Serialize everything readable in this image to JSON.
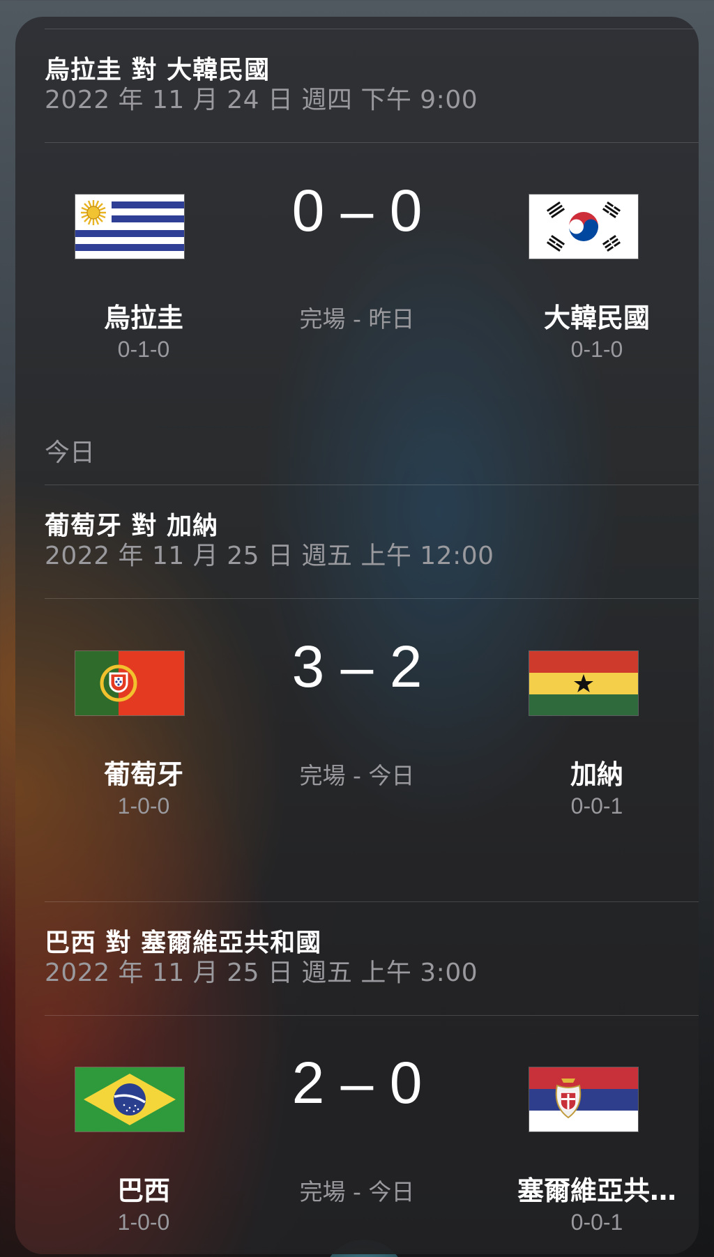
{
  "matches": [
    {
      "title": "烏拉圭 對 大韓民國",
      "datetime": "2022 年 11 月 24 日 週四 下午 9:00",
      "score": "0 – 0",
      "status": "完場 - 昨日",
      "home": {
        "name": "烏拉圭",
        "record": "0-1-0",
        "flag_icon": "uruguay-flag-icon"
      },
      "away": {
        "name": "大韓民國",
        "record": "0-1-0",
        "flag_icon": "south-korea-flag-icon"
      }
    },
    {
      "title": "葡萄牙 對 加納",
      "datetime": "2022 年 11 月 25 日 週五 上午 12:00",
      "score": "3 – 2",
      "status": "完場 - 今日",
      "home": {
        "name": "葡萄牙",
        "record": "1-0-0",
        "flag_icon": "portugal-flag-icon"
      },
      "away": {
        "name": "加納",
        "record": "0-0-1",
        "flag_icon": "ghana-flag-icon"
      }
    },
    {
      "title": "巴西 對 塞爾維亞共和國",
      "datetime": "2022 年 11 月 25 日 週五 上午 3:00",
      "score": "2 – 0",
      "status": "完場 - 今日",
      "home": {
        "name": "巴西",
        "record": "1-0-0",
        "flag_icon": "brazil-flag-icon"
      },
      "away": {
        "name": "塞爾維亞共…",
        "record": "0-0-1",
        "flag_icon": "serbia-flag-icon"
      }
    }
  ],
  "sections": {
    "today": "今日"
  },
  "colors": {
    "text_primary": "#ffffff",
    "text_secondary": "#9a9a9e",
    "card_background": "#2e3034"
  }
}
